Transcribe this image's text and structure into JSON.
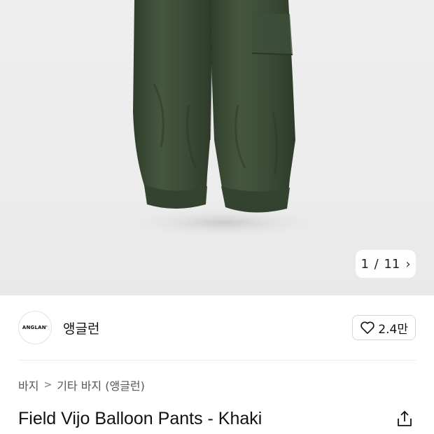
{
  "image_counter": {
    "current": "1",
    "separator": "/",
    "total": "11"
  },
  "brand": {
    "logo_text": "ANGLAN'",
    "name": "앵글런"
  },
  "like": {
    "count": "2.4만"
  },
  "breadcrumb": {
    "items": [
      "바지",
      "기타 바지 (앵글런)"
    ]
  },
  "product": {
    "title": "Field Vijo Balloon Pants - Khaki"
  },
  "colors": {
    "pants": "#3a4a34",
    "background": "#ececec",
    "text": "#111111"
  }
}
